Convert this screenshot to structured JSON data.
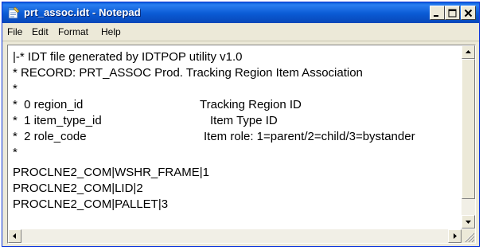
{
  "window": {
    "title": "prt_assoc.idt - Notepad",
    "app_icon": "notepad-icon",
    "controls": [
      "minimize-icon",
      "maximize-icon",
      "close-icon"
    ]
  },
  "menu": {
    "file": "File",
    "edit": "Edit",
    "format": "Format",
    "help": "Help"
  },
  "editor": {
    "lines": [
      "|-* IDT file generated by IDTPOP utility v1.0",
      "* RECORD: PRT_ASSOC Prod. Tracking Region Item Association",
      "*",
      "*  0 region_id",
      "*  1 item_type_id",
      "*  2 role_code",
      "*",
      "PROCLNE2_COM|WSHR_FRAME|1",
      "PROCLNE2_COM|LID|2",
      "PROCLNE2_COM|PALLET|3"
    ],
    "descriptions": [
      "Tracking Region ID",
      "Item Type ID",
      "Item role: 1=parent/2=child/3=bystander"
    ]
  },
  "colors": {
    "titlebar": "#0a5ad4",
    "chrome": "#ece9d8",
    "text": "#000000"
  }
}
